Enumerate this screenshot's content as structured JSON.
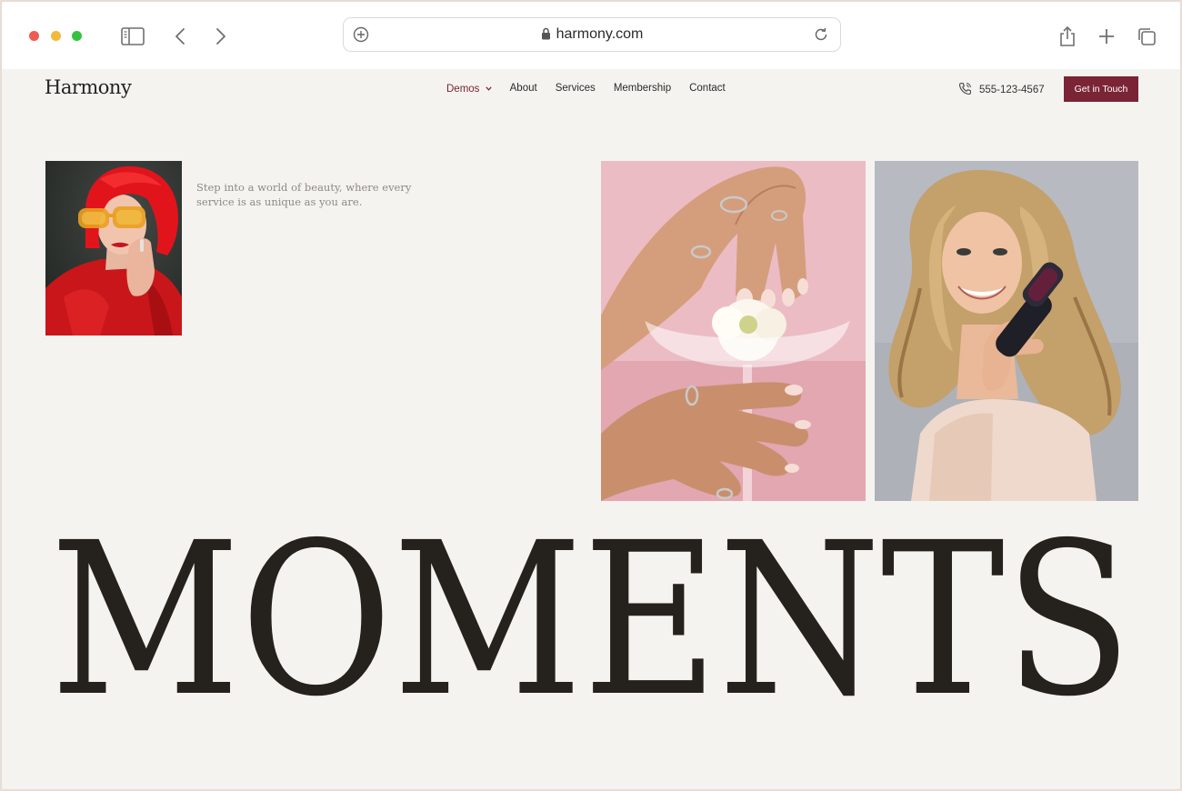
{
  "browser": {
    "url": "harmony.com"
  },
  "site": {
    "logo": "Harmony",
    "nav": [
      {
        "label": "Demos",
        "active": true
      },
      {
        "label": "About"
      },
      {
        "label": "Services"
      },
      {
        "label": "Membership"
      },
      {
        "label": "Contact"
      }
    ],
    "phone": "555-123-4567",
    "cta_label": "Get in Touch",
    "accent_color": "#7a2436"
  },
  "hero": {
    "tagline_line1": "Step into a world of beauty, where every",
    "tagline_line2": "service is as unique as you are.",
    "headline": "MOMENTS",
    "images": [
      {
        "name": "woman-red-hair-yellow-glasses"
      },
      {
        "name": "hands-flower-glass"
      },
      {
        "name": "woman-blonde-hair-brush"
      }
    ]
  }
}
